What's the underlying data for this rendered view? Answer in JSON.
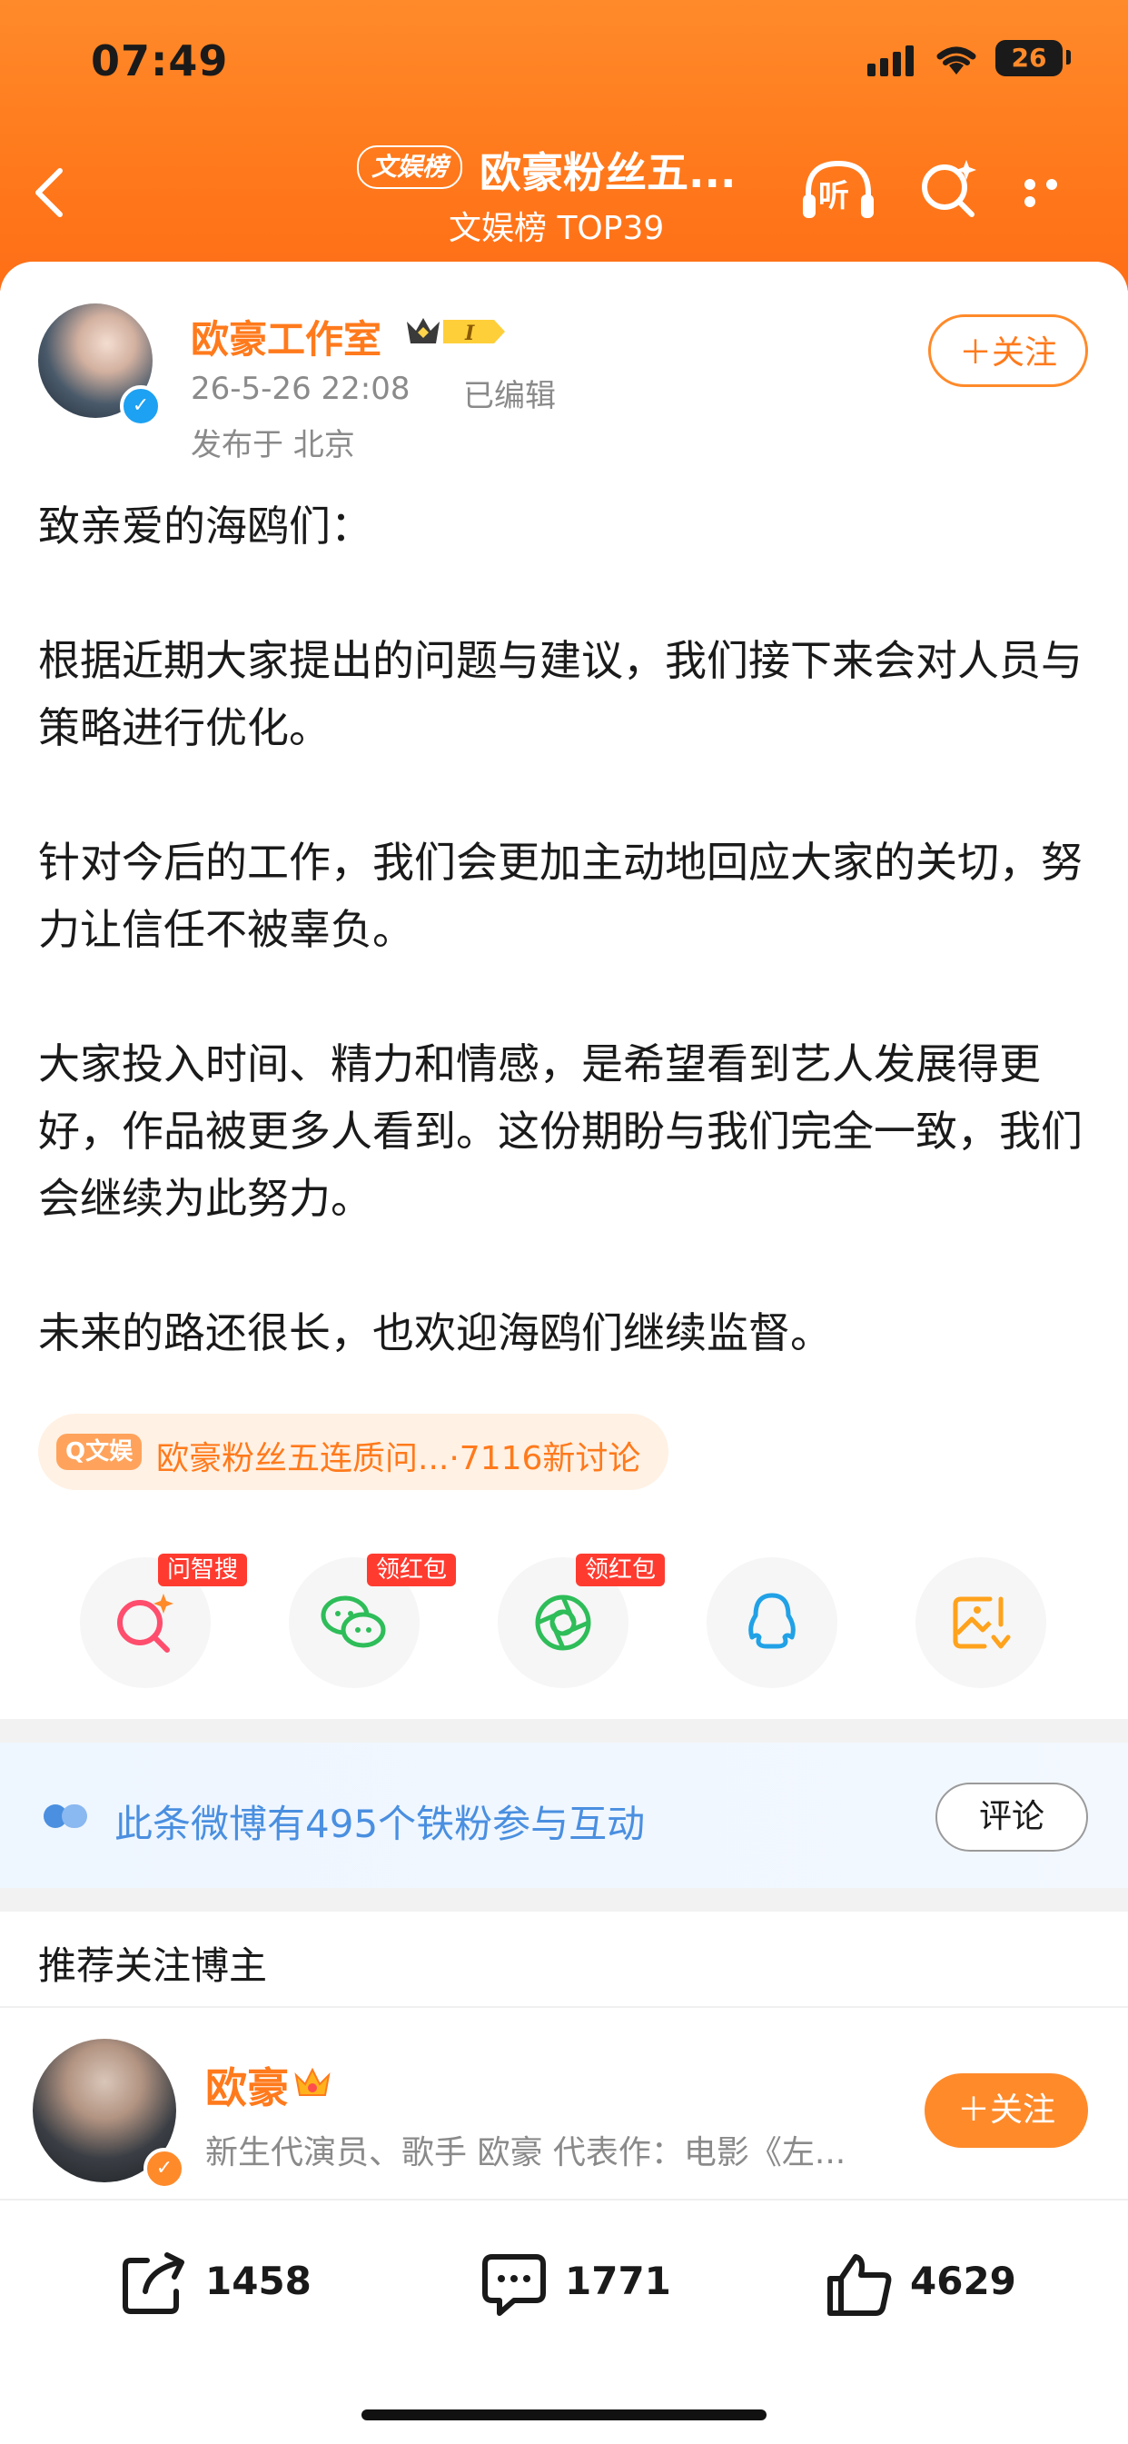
{
  "status_bar": {
    "time": "07:49",
    "battery": "26"
  },
  "header": {
    "topic_pill": "文娱榜",
    "title": "欧豪粉丝五...",
    "subtitle": "文娱榜 TOP39",
    "listen_label": "听"
  },
  "post": {
    "author": "欧豪工作室",
    "timestamp": "26-5-26 22:08",
    "edited": "已编辑",
    "location": "发布于 北京",
    "follow_label": "＋关注",
    "paragraphs": [
      "致亲爱的海鸥们：",
      "根据近期大家提出的问题与建议，我们接下来会对人员与策略进行优化。",
      "针对今后的工作，我们会更加主动地回应大家的关切，努力让信任不被辜负。",
      "大家投入时间、精力和情感，是希望看到艺人发展得更好，作品被更多人看到。这份期盼与我们完全一致，我们会继续为此努力。",
      "未来的路还很长，也欢迎海鸥们继续监督。"
    ],
    "topic_tag": {
      "label": "Q文娱",
      "text": "欧豪粉丝五连质问...",
      "discussions": "·7116新讨论"
    }
  },
  "share_row": {
    "badges": [
      "问智搜",
      "领红包",
      "领红包"
    ],
    "icons": [
      "ai-search-icon",
      "wechat-icon",
      "moments-icon",
      "qq-icon",
      "save-image-icon"
    ]
  },
  "fans_banner": {
    "text": "此条微博有495个铁粉参与互动",
    "comment_label": "评论"
  },
  "recommend": {
    "title": "推荐关注博主",
    "name": "欧豪",
    "description": "新生代演员、歌手 欧豪 代表作：电影《左...",
    "follow_label": "＋关注"
  },
  "bottom_bar": {
    "reposts": "1458",
    "comments": "1771",
    "likes": "4629"
  },
  "colors": {
    "brand_orange": "#ff7a1c",
    "verified_blue": "#1da1f2",
    "badge_red": "#ff3b30",
    "fans_blue": "#4a8fe0"
  }
}
